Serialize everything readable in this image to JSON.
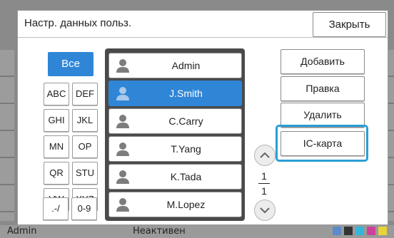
{
  "dialog": {
    "title": "Настр. данных польз.",
    "close_label": "Закрыть"
  },
  "filters": {
    "all": "Все",
    "groups": [
      "ABC",
      "DEF",
      "GHI",
      "JKL",
      "MN",
      "OP",
      "QR",
      "STU",
      "VW",
      "XYZ",
      ".-/",
      "0-9"
    ]
  },
  "users": [
    {
      "name": "Admin",
      "selected": false
    },
    {
      "name": "J.Smith",
      "selected": true
    },
    {
      "name": "C.Carry",
      "selected": false
    },
    {
      "name": "T.Yang",
      "selected": false
    },
    {
      "name": "K.Tada",
      "selected": false
    },
    {
      "name": "M.Lopez",
      "selected": false
    }
  ],
  "pager": {
    "current": "1",
    "total": "1"
  },
  "actions": {
    "add": "Добавить",
    "edit": "Правка",
    "delete": "Удалить",
    "ic_card": "IC-карта"
  },
  "background": {
    "status_user": "Admin",
    "status_state": "Неактивен"
  },
  "colors": {
    "accent": "#2f86d6",
    "highlight": "#2a9fd6",
    "list_frame": "#4a4a4a"
  }
}
